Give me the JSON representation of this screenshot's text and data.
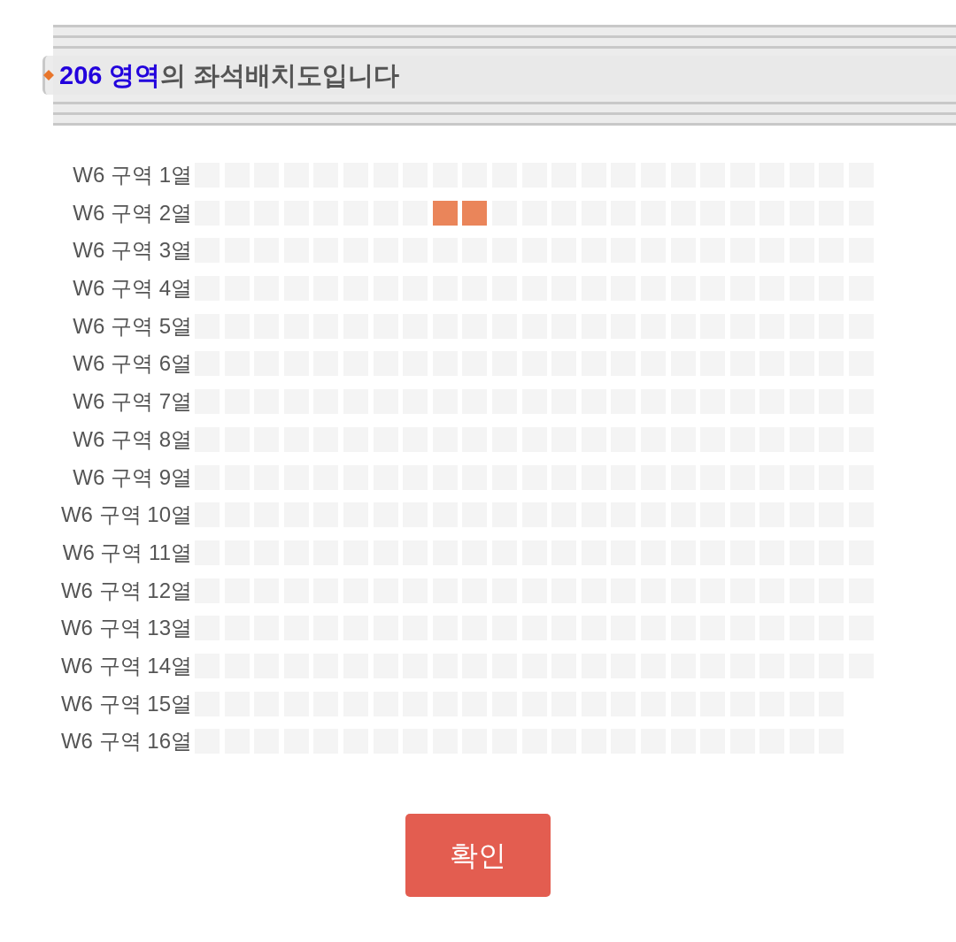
{
  "header": {
    "highlight": "206 영역",
    "text": "의 좌석배치도입니다"
  },
  "rows": [
    {
      "label": "W6 구역 1열",
      "seats": [
        {
          "available": false
        },
        {
          "available": false
        },
        {
          "available": false
        },
        {
          "available": false
        },
        {
          "available": false
        },
        {
          "available": false
        },
        {
          "available": false
        },
        {
          "available": false
        },
        {
          "available": false
        },
        {
          "available": false
        },
        {
          "available": false
        },
        {
          "available": false
        },
        {
          "available": false
        },
        {
          "available": false
        },
        {
          "available": false
        },
        {
          "available": false
        },
        {
          "available": false
        },
        {
          "available": false
        },
        {
          "available": false
        },
        {
          "available": false
        },
        {
          "available": false
        },
        {
          "available": false
        },
        {
          "available": false
        }
      ]
    },
    {
      "label": "W6 구역 2열",
      "seats": [
        {
          "available": false
        },
        {
          "available": false
        },
        {
          "available": false
        },
        {
          "available": false
        },
        {
          "available": false
        },
        {
          "available": false
        },
        {
          "available": false
        },
        {
          "available": false
        },
        {
          "available": true
        },
        {
          "available": true
        },
        {
          "available": false
        },
        {
          "available": false
        },
        {
          "available": false
        },
        {
          "available": false
        },
        {
          "available": false
        },
        {
          "available": false
        },
        {
          "available": false
        },
        {
          "available": false
        },
        {
          "available": false
        },
        {
          "available": false
        },
        {
          "available": false
        },
        {
          "available": false
        },
        {
          "available": false
        }
      ]
    },
    {
      "label": "W6 구역 3열",
      "seats": [
        {
          "available": false
        },
        {
          "available": false
        },
        {
          "available": false
        },
        {
          "available": false
        },
        {
          "available": false
        },
        {
          "available": false
        },
        {
          "available": false
        },
        {
          "available": false
        },
        {
          "available": false
        },
        {
          "available": false
        },
        {
          "available": false
        },
        {
          "available": false
        },
        {
          "available": false
        },
        {
          "available": false
        },
        {
          "available": false
        },
        {
          "available": false
        },
        {
          "available": false
        },
        {
          "available": false
        },
        {
          "available": false
        },
        {
          "available": false
        },
        {
          "available": false
        },
        {
          "available": false
        },
        {
          "available": false
        }
      ]
    },
    {
      "label": "W6 구역 4열",
      "seats": [
        {
          "available": false
        },
        {
          "available": false
        },
        {
          "available": false
        },
        {
          "available": false
        },
        {
          "available": false
        },
        {
          "available": false
        },
        {
          "available": false
        },
        {
          "available": false
        },
        {
          "available": false
        },
        {
          "available": false
        },
        {
          "available": false
        },
        {
          "available": false
        },
        {
          "available": false
        },
        {
          "available": false
        },
        {
          "available": false
        },
        {
          "available": false
        },
        {
          "available": false
        },
        {
          "available": false
        },
        {
          "available": false
        },
        {
          "available": false
        },
        {
          "available": false
        },
        {
          "available": false
        },
        {
          "available": false
        }
      ]
    },
    {
      "label": "W6 구역 5열",
      "seats": [
        {
          "available": false
        },
        {
          "available": false
        },
        {
          "available": false
        },
        {
          "available": false
        },
        {
          "available": false
        },
        {
          "available": false
        },
        {
          "available": false
        },
        {
          "available": false
        },
        {
          "available": false
        },
        {
          "available": false
        },
        {
          "available": false
        },
        {
          "available": false
        },
        {
          "available": false
        },
        {
          "available": false
        },
        {
          "available": false
        },
        {
          "available": false
        },
        {
          "available": false
        },
        {
          "available": false
        },
        {
          "available": false
        },
        {
          "available": false
        },
        {
          "available": false
        },
        {
          "available": false
        },
        {
          "available": false
        }
      ]
    },
    {
      "label": "W6 구역 6열",
      "seats": [
        {
          "available": false
        },
        {
          "available": false
        },
        {
          "available": false
        },
        {
          "available": false
        },
        {
          "available": false
        },
        {
          "available": false
        },
        {
          "available": false
        },
        {
          "available": false
        },
        {
          "available": false
        },
        {
          "available": false
        },
        {
          "available": false
        },
        {
          "available": false
        },
        {
          "available": false
        },
        {
          "available": false
        },
        {
          "available": false
        },
        {
          "available": false
        },
        {
          "available": false
        },
        {
          "available": false
        },
        {
          "available": false
        },
        {
          "available": false
        },
        {
          "available": false
        },
        {
          "available": false
        },
        {
          "available": false
        }
      ]
    },
    {
      "label": "W6 구역 7열",
      "seats": [
        {
          "available": false
        },
        {
          "available": false
        },
        {
          "available": false
        },
        {
          "available": false
        },
        {
          "available": false
        },
        {
          "available": false
        },
        {
          "available": false
        },
        {
          "available": false
        },
        {
          "available": false
        },
        {
          "available": false
        },
        {
          "available": false
        },
        {
          "available": false
        },
        {
          "available": false
        },
        {
          "available": false
        },
        {
          "available": false
        },
        {
          "available": false
        },
        {
          "available": false
        },
        {
          "available": false
        },
        {
          "available": false
        },
        {
          "available": false
        },
        {
          "available": false
        },
        {
          "available": false
        },
        {
          "available": false
        }
      ]
    },
    {
      "label": "W6 구역 8열",
      "seats": [
        {
          "available": false
        },
        {
          "available": false
        },
        {
          "available": false
        },
        {
          "available": false
        },
        {
          "available": false
        },
        {
          "available": false
        },
        {
          "available": false
        },
        {
          "available": false
        },
        {
          "available": false
        },
        {
          "available": false
        },
        {
          "available": false
        },
        {
          "available": false
        },
        {
          "available": false
        },
        {
          "available": false
        },
        {
          "available": false
        },
        {
          "available": false
        },
        {
          "available": false
        },
        {
          "available": false
        },
        {
          "available": false
        },
        {
          "available": false
        },
        {
          "available": false
        },
        {
          "available": false
        },
        {
          "available": false
        }
      ]
    },
    {
      "label": "W6 구역 9열",
      "seats": [
        {
          "available": false
        },
        {
          "available": false
        },
        {
          "available": false
        },
        {
          "available": false
        },
        {
          "available": false
        },
        {
          "available": false
        },
        {
          "available": false
        },
        {
          "available": false
        },
        {
          "available": false
        },
        {
          "available": false
        },
        {
          "available": false
        },
        {
          "available": false
        },
        {
          "available": false
        },
        {
          "available": false
        },
        {
          "available": false
        },
        {
          "available": false
        },
        {
          "available": false
        },
        {
          "available": false
        },
        {
          "available": false
        },
        {
          "available": false
        },
        {
          "available": false
        },
        {
          "available": false
        },
        {
          "available": false
        }
      ]
    },
    {
      "label": "W6 구역 10열",
      "seats": [
        {
          "available": false
        },
        {
          "available": false
        },
        {
          "available": false
        },
        {
          "available": false
        },
        {
          "available": false
        },
        {
          "available": false
        },
        {
          "available": false
        },
        {
          "available": false
        },
        {
          "available": false
        },
        {
          "available": false
        },
        {
          "available": false
        },
        {
          "available": false
        },
        {
          "available": false
        },
        {
          "available": false
        },
        {
          "available": false
        },
        {
          "available": false
        },
        {
          "available": false
        },
        {
          "available": false
        },
        {
          "available": false
        },
        {
          "available": false
        },
        {
          "available": false
        },
        {
          "available": false
        },
        {
          "available": false
        }
      ]
    },
    {
      "label": "W6 구역 11열",
      "seats": [
        {
          "available": false
        },
        {
          "available": false
        },
        {
          "available": false
        },
        {
          "available": false
        },
        {
          "available": false
        },
        {
          "available": false
        },
        {
          "available": false
        },
        {
          "available": false
        },
        {
          "available": false
        },
        {
          "available": false
        },
        {
          "available": false
        },
        {
          "available": false
        },
        {
          "available": false
        },
        {
          "available": false
        },
        {
          "available": false
        },
        {
          "available": false
        },
        {
          "available": false
        },
        {
          "available": false
        },
        {
          "available": false
        },
        {
          "available": false
        },
        {
          "available": false
        },
        {
          "available": false
        },
        {
          "available": false
        }
      ]
    },
    {
      "label": "W6 구역 12열",
      "seats": [
        {
          "available": false
        },
        {
          "available": false
        },
        {
          "available": false
        },
        {
          "available": false
        },
        {
          "available": false
        },
        {
          "available": false
        },
        {
          "available": false
        },
        {
          "available": false
        },
        {
          "available": false
        },
        {
          "available": false
        },
        {
          "available": false
        },
        {
          "available": false
        },
        {
          "available": false
        },
        {
          "available": false
        },
        {
          "available": false
        },
        {
          "available": false
        },
        {
          "available": false
        },
        {
          "available": false
        },
        {
          "available": false
        },
        {
          "available": false
        },
        {
          "available": false
        },
        {
          "available": false
        },
        {
          "available": false
        }
      ]
    },
    {
      "label": "W6 구역 13열",
      "seats": [
        {
          "available": false
        },
        {
          "available": false
        },
        {
          "available": false
        },
        {
          "available": false
        },
        {
          "available": false
        },
        {
          "available": false
        },
        {
          "available": false
        },
        {
          "available": false
        },
        {
          "available": false
        },
        {
          "available": false
        },
        {
          "available": false
        },
        {
          "available": false
        },
        {
          "available": false
        },
        {
          "available": false
        },
        {
          "available": false
        },
        {
          "available": false
        },
        {
          "available": false
        },
        {
          "available": false
        },
        {
          "available": false
        },
        {
          "available": false
        },
        {
          "available": false
        },
        {
          "available": false
        },
        {
          "available": false
        }
      ]
    },
    {
      "label": "W6 구역 14열",
      "seats": [
        {
          "available": false
        },
        {
          "available": false
        },
        {
          "available": false
        },
        {
          "available": false
        },
        {
          "available": false
        },
        {
          "available": false
        },
        {
          "available": false
        },
        {
          "available": false
        },
        {
          "available": false
        },
        {
          "available": false
        },
        {
          "available": false
        },
        {
          "available": false
        },
        {
          "available": false
        },
        {
          "available": false
        },
        {
          "available": false
        },
        {
          "available": false
        },
        {
          "available": false
        },
        {
          "available": false
        },
        {
          "available": false
        },
        {
          "available": false
        },
        {
          "available": false
        },
        {
          "available": false
        },
        {
          "available": false
        }
      ]
    },
    {
      "label": "W6 구역 15열",
      "seats": [
        {
          "available": false
        },
        {
          "available": false
        },
        {
          "available": false
        },
        {
          "available": false
        },
        {
          "available": false
        },
        {
          "available": false
        },
        {
          "available": false
        },
        {
          "available": false
        },
        {
          "available": false
        },
        {
          "available": false
        },
        {
          "available": false
        },
        {
          "available": false
        },
        {
          "available": false
        },
        {
          "available": false
        },
        {
          "available": false
        },
        {
          "available": false
        },
        {
          "available": false
        },
        {
          "available": false
        },
        {
          "available": false
        },
        {
          "available": false
        },
        {
          "available": false
        },
        {
          "available": false
        }
      ]
    },
    {
      "label": "W6 구역 16열",
      "seats": [
        {
          "available": false
        },
        {
          "available": false
        },
        {
          "available": false
        },
        {
          "available": false
        },
        {
          "available": false
        },
        {
          "available": false
        },
        {
          "available": false
        },
        {
          "available": false
        },
        {
          "available": false
        },
        {
          "available": false
        },
        {
          "available": false
        },
        {
          "available": false
        },
        {
          "available": false
        },
        {
          "available": false
        },
        {
          "available": false
        },
        {
          "available": false
        },
        {
          "available": false
        },
        {
          "available": false
        },
        {
          "available": false
        },
        {
          "available": false
        },
        {
          "available": false
        },
        {
          "available": false
        }
      ]
    }
  ],
  "confirm_button": "확인"
}
